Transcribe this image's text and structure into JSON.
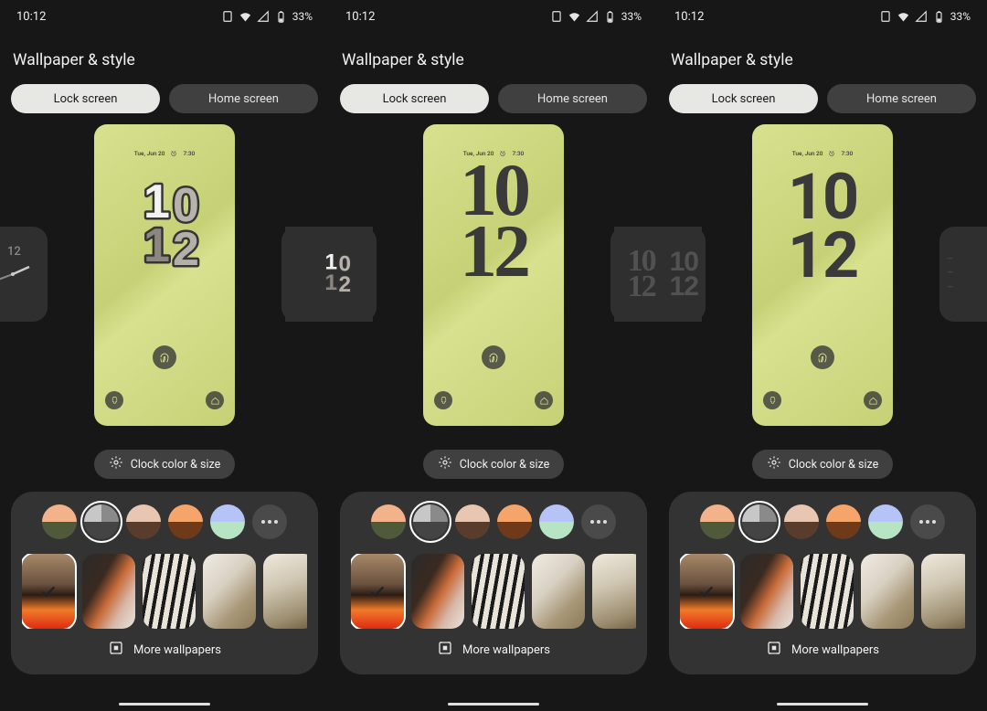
{
  "statusbar": {
    "time": "10:12",
    "battery_pct": "33%"
  },
  "page_title": "Wallpaper & style",
  "tabs": {
    "lock": "Lock screen",
    "home": "Home screen"
  },
  "lock_meta": {
    "date": "Tue, Jun 20",
    "alarm": "7:30"
  },
  "clock_time": {
    "hh": "10",
    "mm": "12"
  },
  "clock_chip_label": "Clock color & size",
  "more_wallpapers_label": "More wallpapers",
  "color_swatches": [
    {
      "q": [
        "#f3b38a",
        "#f3b38a",
        "#4f5a3a",
        "#4f5a3a"
      ],
      "selected": false
    },
    {
      "q": [
        "#c7c7c7",
        "#8a8a8a",
        "#444444",
        "#444444"
      ],
      "selected": true
    },
    {
      "q": [
        "#e9c6b2",
        "#e9c6b2",
        "#5a3c2c",
        "#5a3c2c"
      ],
      "selected": false
    },
    {
      "q": [
        "#f6a56a",
        "#f6a56a",
        "#6f3a1a",
        "#6f3a1a"
      ],
      "selected": false
    },
    {
      "q": [
        "#b5c3f7",
        "#b5c3f7",
        "#b7e4c2",
        "#b7e4c2"
      ],
      "selected": false
    }
  ],
  "wallpapers": [
    {
      "class": "wt0",
      "selected": true
    },
    {
      "class": "wt1",
      "selected": false
    },
    {
      "class": "wt2",
      "selected": false
    },
    {
      "class": "wt3",
      "selected": false
    },
    {
      "class": "wt4",
      "selected": false
    }
  ],
  "panes": [
    {
      "clock_style": "a",
      "left_card": "analog",
      "right_card": "serif_plus_bubble"
    },
    {
      "clock_style": "b",
      "left_card": "bubble_mini",
      "right_card": "sans_mini"
    },
    {
      "clock_style": "c",
      "left_card": "serif_mini",
      "right_card": "edge_mini"
    }
  ]
}
